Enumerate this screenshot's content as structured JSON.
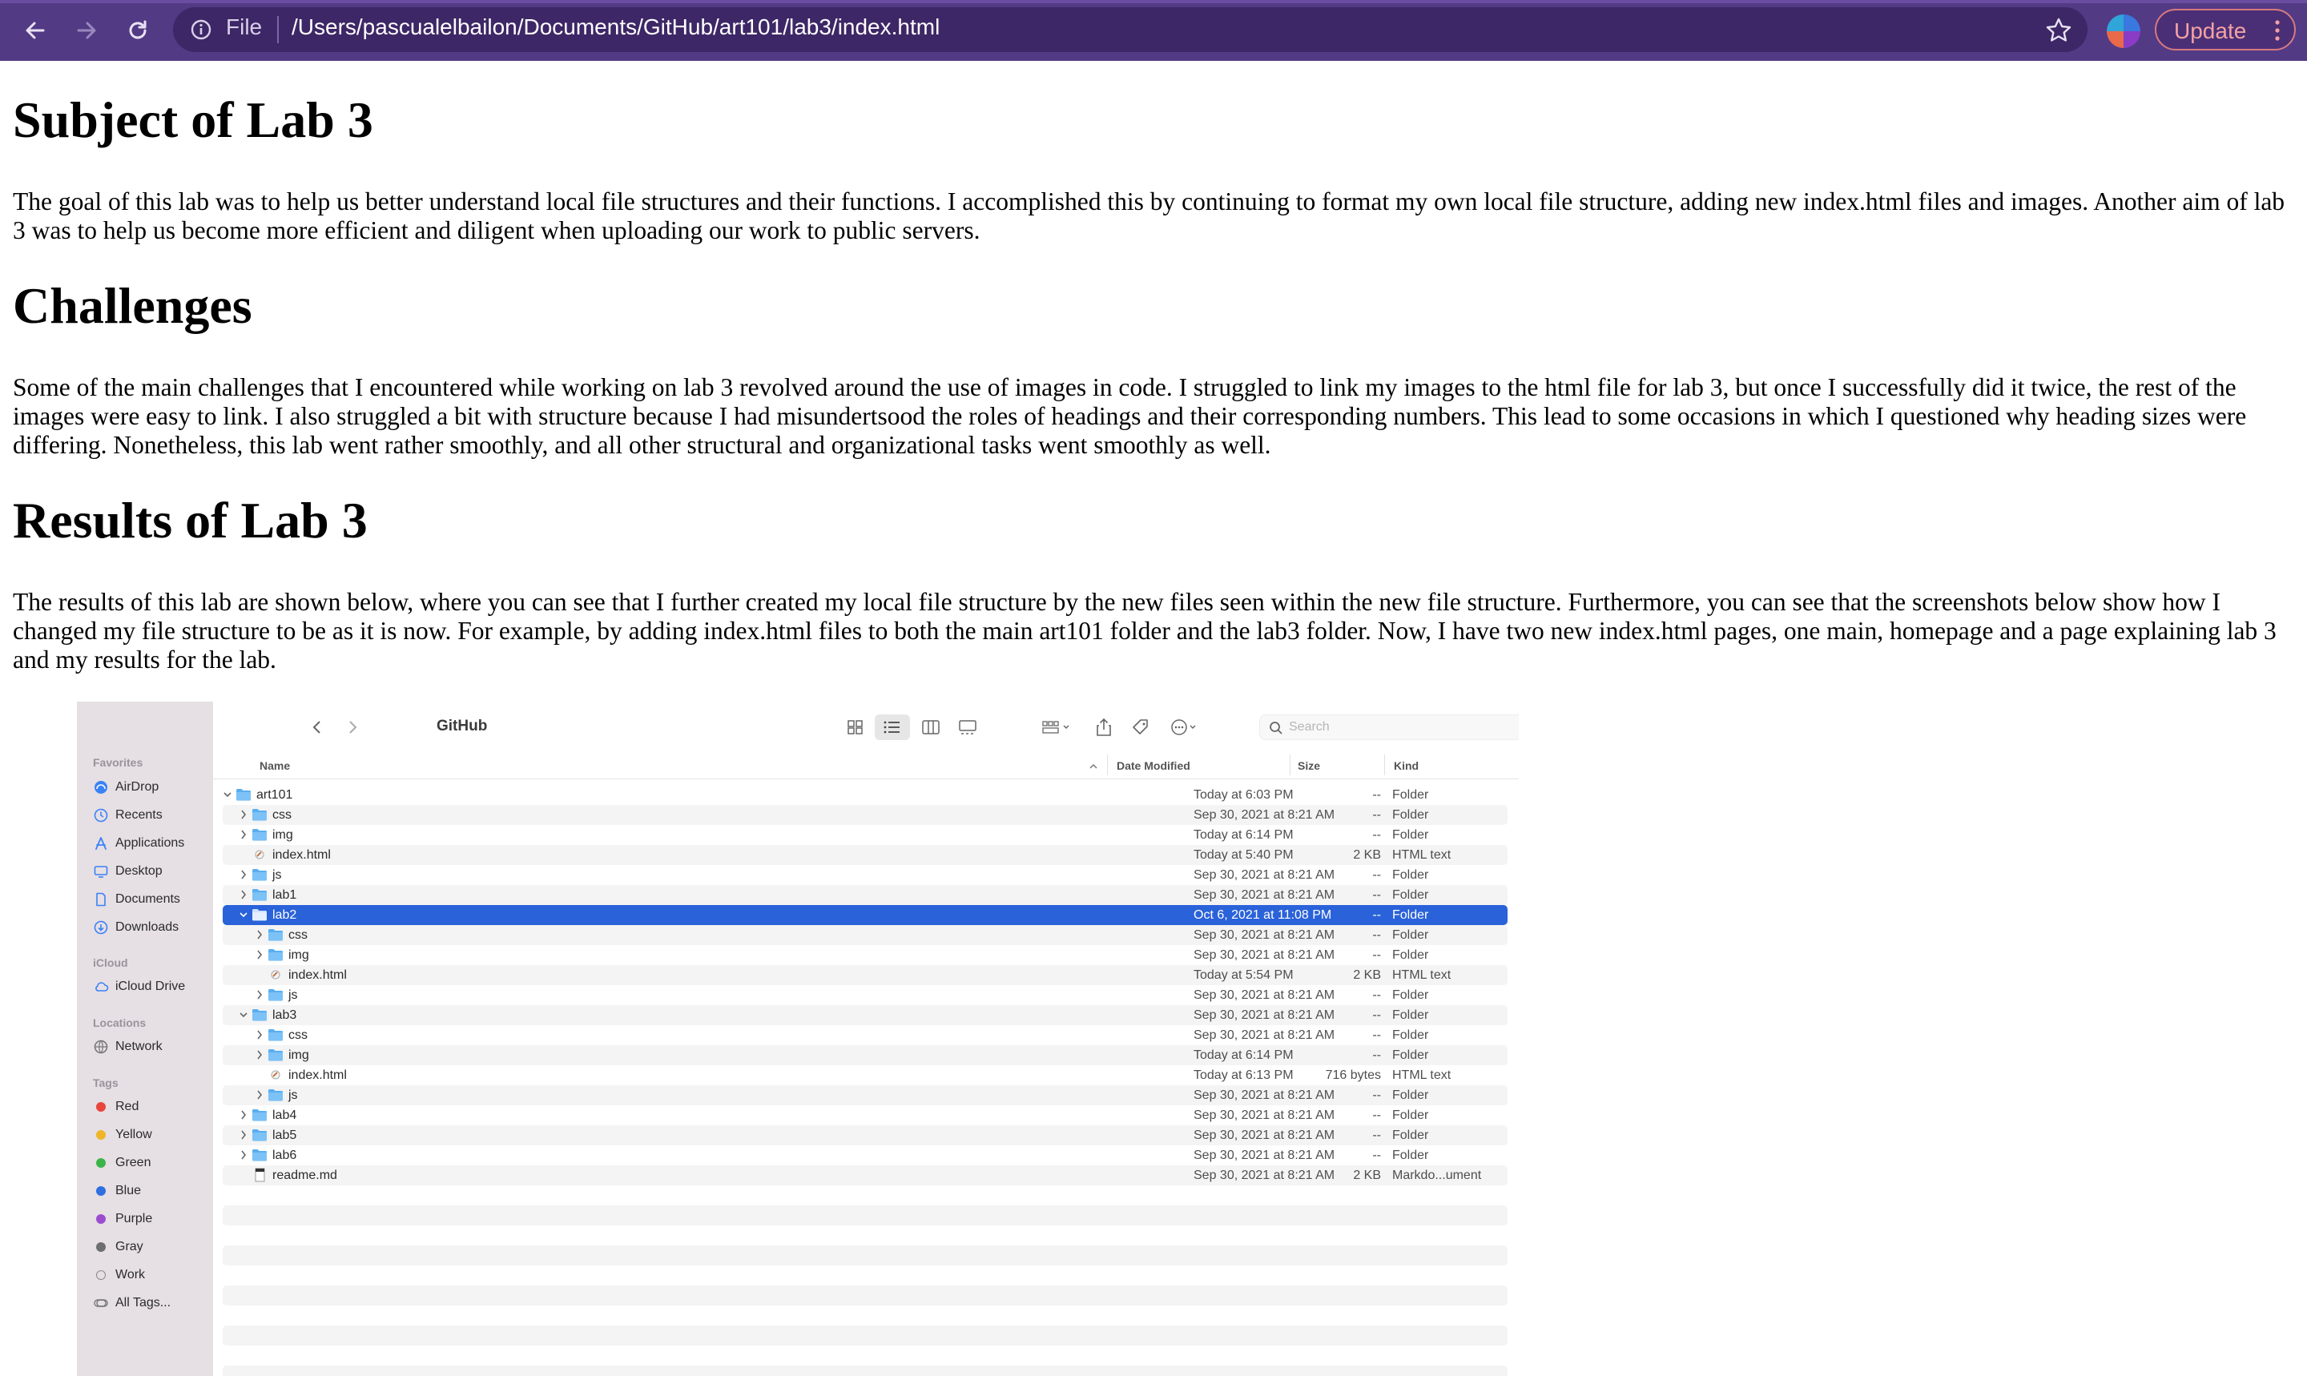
{
  "browser": {
    "file_label": "File",
    "url": "/Users/pascualelbailon/Documents/GitHub/art101/lab3/index.html",
    "update_label": "Update"
  },
  "page": {
    "sections": [
      {
        "heading": "Subject of Lab 3",
        "paragraph": "The goal of this lab was to help us better understand local file structures and their functions. I accomplished this by continuing to format my own local file structure, adding new index.html files and images. Another aim of lab 3 was to help us become more efficient and diligent when uploading our work to public servers."
      },
      {
        "heading": "Challenges",
        "paragraph": "Some of the main challenges that I encountered while working on lab 3 revolved around the use of images in code. I struggled to link my images to the html file for lab 3, but once I successfully did it twice, the rest of the images were easy to link. I also struggled a bit with structure because I had misundertsood the roles of headings and their corresponding numbers. This lead to some occasions in which I questioned why heading sizes were differing. Nonetheless, this lab went rather smoothly, and all other structural and organizational tasks went smoothly as well."
      },
      {
        "heading": "Results of Lab 3",
        "paragraph": "The results of this lab are shown below, where you can see that I further created my local file structure by the new files seen within the new file structure. Furthermore, you can see that the screenshots below show how I changed my file structure to be as it is now. For example, by adding index.html files to both the main art101 folder and the lab3 folder. Now, I have two new index.html pages, one main, homepage and a page explaining lab 3 and my results for the lab."
      }
    ]
  },
  "finder": {
    "title": "GitHub",
    "search_placeholder": "Search",
    "columns": {
      "name": "Name",
      "date": "Date Modified",
      "size": "Size",
      "kind": "Kind"
    },
    "sidebar": {
      "favorites_label": "Favorites",
      "favorites": [
        "AirDrop",
        "Recents",
        "Applications",
        "Desktop",
        "Documents",
        "Downloads"
      ],
      "icloud_label": "iCloud",
      "icloud": [
        "iCloud Drive"
      ],
      "locations_label": "Locations",
      "locations": [
        "Network"
      ],
      "tags_label": "Tags",
      "tags": [
        {
          "name": "Red",
          "color": "#e8453c"
        },
        {
          "name": "Yellow",
          "color": "#f0b429"
        },
        {
          "name": "Green",
          "color": "#3bb54a"
        },
        {
          "name": "Blue",
          "color": "#2f6fe0"
        },
        {
          "name": "Purple",
          "color": "#9b4dd0"
        },
        {
          "name": "Gray",
          "color": "#6e6e6e"
        },
        {
          "name": "Work",
          "color": ""
        },
        {
          "name": "All Tags...",
          "color": ""
        }
      ]
    },
    "rows": [
      {
        "name": "art101",
        "level": 0,
        "type": "folder",
        "expanded": true,
        "date": "Today at 6:03 PM",
        "size": "--",
        "kind": "Folder"
      },
      {
        "name": "css",
        "level": 1,
        "type": "folder",
        "expanded": false,
        "date": "Sep 30, 2021 at 8:21 AM",
        "size": "--",
        "kind": "Folder"
      },
      {
        "name": "img",
        "level": 1,
        "type": "folder",
        "expanded": false,
        "date": "Today at 6:14 PM",
        "size": "--",
        "kind": "Folder"
      },
      {
        "name": "index.html",
        "level": 1,
        "type": "file",
        "expanded": false,
        "date": "Today at 5:40 PM",
        "size": "2 KB",
        "kind": "HTML text"
      },
      {
        "name": "js",
        "level": 1,
        "type": "folder",
        "expanded": false,
        "date": "Sep 30, 2021 at 8:21 AM",
        "size": "--",
        "kind": "Folder"
      },
      {
        "name": "lab1",
        "level": 1,
        "type": "folder",
        "expanded": false,
        "date": "Sep 30, 2021 at 8:21 AM",
        "size": "--",
        "kind": "Folder"
      },
      {
        "name": "lab2",
        "level": 1,
        "type": "folder",
        "expanded": true,
        "selected": true,
        "date": "Oct 6, 2021 at 11:08 PM",
        "size": "--",
        "kind": "Folder"
      },
      {
        "name": "css",
        "level": 2,
        "type": "folder",
        "expanded": false,
        "date": "Sep 30, 2021 at 8:21 AM",
        "size": "--",
        "kind": "Folder"
      },
      {
        "name": "img",
        "level": 2,
        "type": "folder",
        "expanded": false,
        "date": "Sep 30, 2021 at 8:21 AM",
        "size": "--",
        "kind": "Folder"
      },
      {
        "name": "index.html",
        "level": 2,
        "type": "file",
        "expanded": false,
        "date": "Today at 5:54 PM",
        "size": "2 KB",
        "kind": "HTML text"
      },
      {
        "name": "js",
        "level": 2,
        "type": "folder",
        "expanded": false,
        "date": "Sep 30, 2021 at 8:21 AM",
        "size": "--",
        "kind": "Folder"
      },
      {
        "name": "lab3",
        "level": 1,
        "type": "folder",
        "expanded": true,
        "date": "Sep 30, 2021 at 8:21 AM",
        "size": "--",
        "kind": "Folder"
      },
      {
        "name": "css",
        "level": 2,
        "type": "folder",
        "expanded": false,
        "date": "Sep 30, 2021 at 8:21 AM",
        "size": "--",
        "kind": "Folder"
      },
      {
        "name": "img",
        "level": 2,
        "type": "folder",
        "expanded": false,
        "date": "Today at 6:14 PM",
        "size": "--",
        "kind": "Folder"
      },
      {
        "name": "index.html",
        "level": 2,
        "type": "file",
        "expanded": false,
        "date": "Today at 6:13 PM",
        "size": "716 bytes",
        "kind": "HTML text"
      },
      {
        "name": "js",
        "level": 2,
        "type": "folder",
        "expanded": false,
        "date": "Sep 30, 2021 at 8:21 AM",
        "size": "--",
        "kind": "Folder"
      },
      {
        "name": "lab4",
        "level": 1,
        "type": "folder",
        "expanded": false,
        "date": "Sep 30, 2021 at 8:21 AM",
        "size": "--",
        "kind": "Folder"
      },
      {
        "name": "lab5",
        "level": 1,
        "type": "folder",
        "expanded": false,
        "date": "Sep 30, 2021 at 8:21 AM",
        "size": "--",
        "kind": "Folder"
      },
      {
        "name": "lab6",
        "level": 1,
        "type": "folder",
        "expanded": false,
        "date": "Sep 30, 2021 at 8:21 AM",
        "size": "--",
        "kind": "Folder"
      },
      {
        "name": "readme.md",
        "level": 1,
        "type": "doc",
        "expanded": false,
        "date": "Sep 30, 2021 at 8:21 AM",
        "size": "2 KB",
        "kind": "Markdo...ument"
      }
    ]
  }
}
